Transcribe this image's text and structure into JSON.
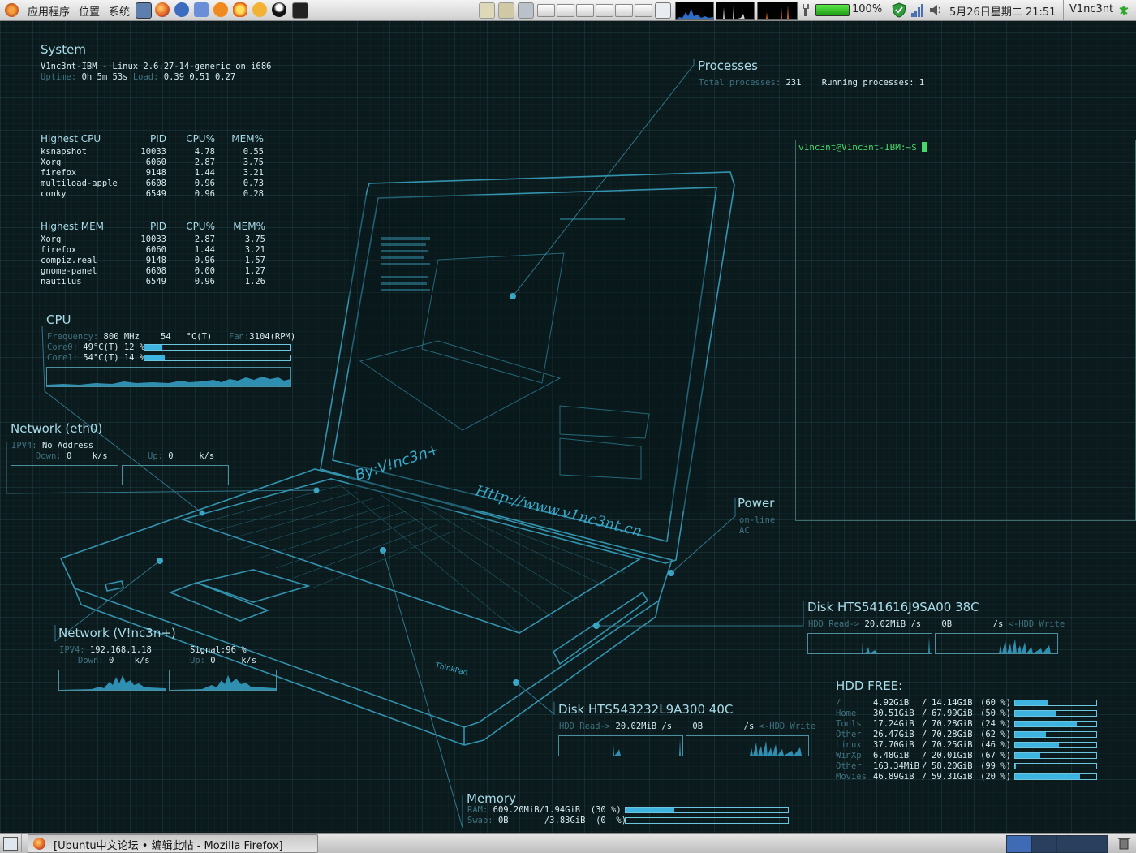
{
  "top_panel": {
    "menus": [
      "应用程序",
      "位置",
      "系统"
    ],
    "battery": "100%",
    "datetime": "5月26日星期二 21:51",
    "user": "V1nc3nt"
  },
  "bottom_panel": {
    "task": "[Ubuntu中文论坛 • 编辑此帖 - Mozilla Firefox]"
  },
  "system": {
    "title": "System",
    "line1": "V1nc3nt-IBM - Linux 2.6.27-14-generic on i686",
    "uptime_label": "Uptime:",
    "uptime": "0h 5m 53s",
    "load_label": "Load:",
    "load": "0.39 0.51 0.27"
  },
  "highest_cpu": {
    "headers": [
      "Highest CPU",
      "PID",
      "CPU%",
      "MEM%"
    ],
    "rows": [
      [
        "ksnapshot",
        "10033",
        "4.78",
        "0.55"
      ],
      [
        "Xorg",
        "6060",
        "2.87",
        "3.75"
      ],
      [
        "firefox",
        "9148",
        "1.44",
        "3.21"
      ],
      [
        "multiload-apple",
        "6608",
        "0.96",
        "0.73"
      ],
      [
        "conky",
        "6549",
        "0.96",
        "0.28"
      ]
    ]
  },
  "highest_mem": {
    "headers": [
      "Highest MEM",
      "PID",
      "CPU%",
      "MEM%"
    ],
    "rows": [
      [
        "Xorg",
        "10033",
        "2.87",
        "3.75"
      ],
      [
        "firefox",
        "6060",
        "1.44",
        "3.21"
      ],
      [
        "compiz.real",
        "9148",
        "0.96",
        "1.57"
      ],
      [
        "gnome-panel",
        "6608",
        "0.00",
        "1.27"
      ],
      [
        "nautilus",
        "6549",
        "0.96",
        "1.26"
      ]
    ]
  },
  "cpu": {
    "title": "CPU",
    "freq_label": "Frequency:",
    "freq": "800 MHz",
    "temp": "54",
    "temp_unit": "°C(T)",
    "fan_label": "Fan:",
    "fan": "3104(RPM)",
    "core0_label": "Core0:",
    "core0_temp": "49°C(T)",
    "core0_pct": "12 %",
    "core0_level": 0.12,
    "core1_label": "Core1:",
    "core1_temp": "54°C(T)",
    "core1_pct": "14 %",
    "core1_level": 0.14
  },
  "net_eth0": {
    "title": "Network (eth0)",
    "ip_label": "IPV4:",
    "ip": "No Address",
    "down_label": "Down:",
    "down": "0",
    "down_unit": "k/s",
    "up_label": "Up:",
    "up": "0",
    "up_unit": "k/s"
  },
  "net_wifi": {
    "title": "Network (V!nc3n+)",
    "ip_label": "IPV4:",
    "ip": "192.168.1.18",
    "signal_label": "Signal:",
    "signal": "96 %",
    "down_label": "Down:",
    "down": "0",
    "down_unit": "k/s",
    "up_label": "Up:",
    "up": "0",
    "up_unit": "k/s"
  },
  "processes": {
    "title": "Processes",
    "total_label": "Total processes:",
    "total": "231",
    "running_label": "Running processes:",
    "running": "1"
  },
  "terminal": {
    "prompt": "v1nc3nt@V1nc3nt-IBM:~$"
  },
  "power": {
    "title": "Power",
    "status1": "on-line",
    "status2": "AC"
  },
  "disk1": {
    "title": "Disk HTS541616J9SA00 38C",
    "read_label": "HDD Read->",
    "read": "20.02MiB /s",
    "write": "0B",
    "write_unit": "/s",
    "write_label": "<-HDD Write"
  },
  "disk2": {
    "title": "Disk HTS543232L9A300 40C",
    "read_label": "HDD Read->",
    "read": "20.02MiB /s",
    "write": "0B",
    "write_unit": "/s",
    "write_label": "<-HDD Write"
  },
  "hdd_free": {
    "title": "HDD FREE:",
    "rows": [
      {
        "name": "/",
        "used": "4.92GiB",
        "sep": "/",
        "total": "14.14GiB",
        "pct": "(60 %)",
        "level": 0.4
      },
      {
        "name": "Home",
        "used": "30.51GiB",
        "sep": "/",
        "total": "67.99GiB",
        "pct": "(50 %)",
        "level": 0.5
      },
      {
        "name": "Tools",
        "used": "17.24GiB",
        "sep": "/",
        "total": "70.28GiB",
        "pct": "(24 %)",
        "level": 0.76
      },
      {
        "name": "Other",
        "used": "26.47GiB",
        "sep": "/",
        "total": "70.28GiB",
        "pct": "(62 %)",
        "level": 0.38
      },
      {
        "name": "Linux",
        "used": "37.70GiB",
        "sep": "/",
        "total": "70.25GiB",
        "pct": "(46 %)",
        "level": 0.54
      },
      {
        "name": "WinXp",
        "used": "6.48GiB",
        "sep": "/",
        "total": "20.01GiB",
        "pct": "(67 %)",
        "level": 0.31
      },
      {
        "name": "Other",
        "used": "163.34MiB",
        "sep": "/",
        "total": "58.20GiB",
        "pct": "(99 %)",
        "level": 0.01
      },
      {
        "name": "Movies",
        "used": "46.89GiB",
        "sep": "/",
        "total": "59.31GiB",
        "pct": "(20 %)",
        "level": 0.8
      }
    ]
  },
  "memory": {
    "title": "Memory",
    "ram_label": "RAM:",
    "ram": "609.20MiB/1.94GiB",
    "ram_pct": "(30 %)",
    "ram_level": 0.3,
    "swap_label": "Swap:",
    "swap": "0B",
    "swap_total": "/3.83GiB",
    "swap_pct": "(0  %)",
    "swap_level": 0.0
  },
  "laptop": {
    "sig1": "By:V!nc3n+",
    "sig2": "Http://www.v1nc3nt.cn",
    "brand": "ThinkPad"
  },
  "colors": {
    "accent": "#3db3df",
    "panel": "#d9d9d9",
    "background": "#0b1a1c"
  }
}
